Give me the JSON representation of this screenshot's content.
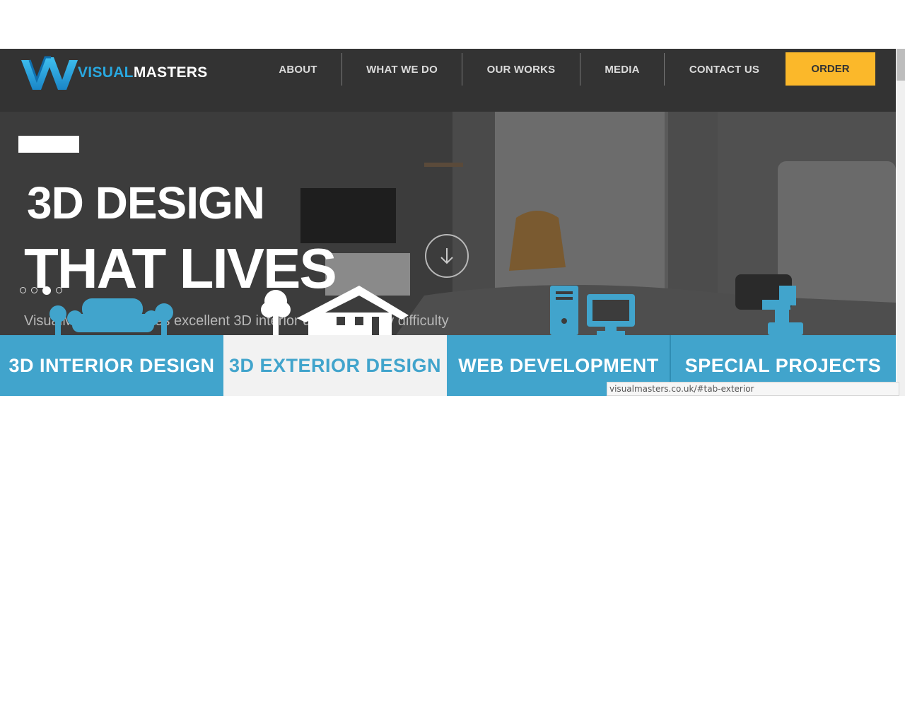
{
  "brand": {
    "word_visual": "VISUAL",
    "word_masters": "MASTERS",
    "accent": "#29a8e0"
  },
  "nav": {
    "items": [
      {
        "label": "ABOUT"
      },
      {
        "label": "WHAT WE DO"
      },
      {
        "label": "OUR WORKS"
      },
      {
        "label": "MEDIA"
      },
      {
        "label": "CONTACT US"
      }
    ],
    "order_label": "ORDER",
    "order_color": "#fbb82a"
  },
  "hero": {
    "title_line1": "3D DESIGN",
    "title_line2": "THAT LIVES",
    "subtitle": "VisualMasters provides excellent 3D interior designs of any difficulty",
    "slides_total": 4,
    "active_slide": 3
  },
  "tabs": [
    {
      "label": "3D INTERIOR DESIGN",
      "icon": "sofa-icon",
      "active": false
    },
    {
      "label": "3D EXTERIOR DESIGN",
      "icon": "house-icon",
      "active": true
    },
    {
      "label": "WEB DEVELOPMENT",
      "icon": "computer-icon",
      "active": false
    },
    {
      "label": "SPECIAL PROJECTS",
      "icon": "robot-arm-icon",
      "active": false
    }
  ],
  "colors": {
    "tab_blue": "#41a4cc",
    "header_bg": "#333333",
    "active_tab_bg": "#f2f2f2"
  },
  "status_bar": {
    "url": "visualmasters.co.uk/#tab-exterior"
  }
}
